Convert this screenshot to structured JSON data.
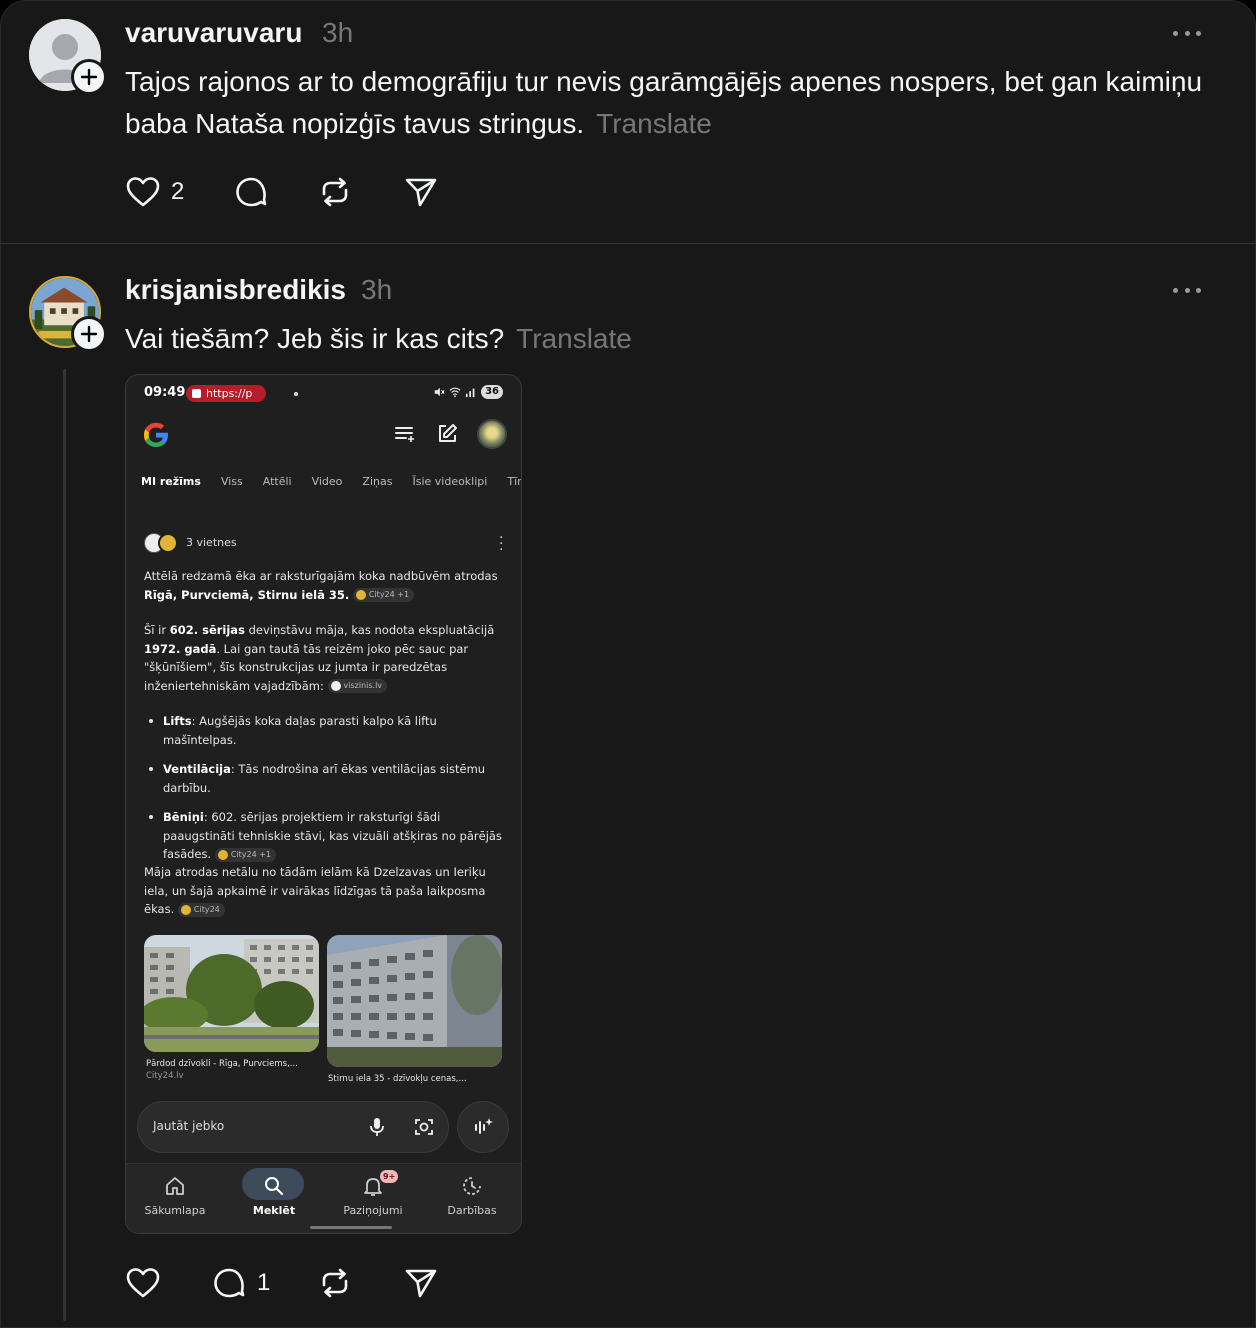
{
  "post1": {
    "username": "varuvaruvaru",
    "time": "3h",
    "text": "Tajos rajonos ar to demogrāfiju tur nevis garāmgājējs apenes nospers, bet gan kaimiņu baba Nataša nopizģīs tavus stringus.",
    "translate": "Translate",
    "likes": "2",
    "replies": ""
  },
  "post2": {
    "username": "krisjanisbredikis",
    "time": "3h",
    "text": "Vai tiešām? Jeb šis ir kas cits?",
    "translate": "Translate",
    "likes": "",
    "replies": "1"
  },
  "phone": {
    "clock": "09:49",
    "url": "https://p",
    "battery": "36",
    "tabs": [
      "MI režīms",
      "Viss",
      "Attēli",
      "Video",
      "Ziņas",
      "Īsie videoklipi",
      "Tīmekl"
    ],
    "sites_label": "3 vietnes",
    "p1_a": "Attēlā redzamā ēka ar raksturīgajām koka nadbūvēm atrodas ",
    "p1_b": "Rīgā, Purvciemā, Stirnu ielā 35.",
    "chip_city24_plus": "City24 +1",
    "p2_a": "Šī ir ",
    "p2_b": "602. sērijas",
    "p2_c": " deviņstāvu māja, kas nodota ekspluatācijā ",
    "p2_d": "1972. gadā",
    "p2_e": ". Lai gan tautā tās reizēm joko pēc sauc par \"šķūnīšiem\", šīs konstrukcijas uz jumta ir paredzētas inženiertehniskām vajadzībām:",
    "chip_viszinis": "viszinis.lv",
    "b1_t": "Lifts",
    "b1_d": ": Augšējās koka daļas parasti kalpo kā liftu mašīntelpas.",
    "b2_t": "Ventilācija",
    "b2_d": ": Tās nodrošina arī ēkas ventilācijas sistēmu darbību.",
    "b3_t": "Bēniņi",
    "b3_d": ": 602. sērijas projektiem ir raksturīgi šādi paaugstināti tehniskie stāvi, kas vizuāli atšķiras no pārējās fasādes.",
    "chip_city24_plus2": "City24 +1",
    "p3": "Māja atrodas netālu no tādām ielām kā Dzelzavas un Ieriķu iela, un šajā apkaimē ir vairākas līdzīgas tā paša laikposma ēkas.",
    "chip_city24": "City24",
    "img1_caption": "Pārdod dzīvokli - Rīga, Purvciems,...",
    "img1_source": "City24.lv",
    "img2_caption": "Stirnu iela 35 - dzīvokļu cenas,...",
    "ask_placeholder": "Jautāt jebko",
    "nav": [
      "Sākumlapa",
      "Meklēt",
      "Paziņojumi",
      "Darbības"
    ],
    "notif_badge": "9+"
  }
}
